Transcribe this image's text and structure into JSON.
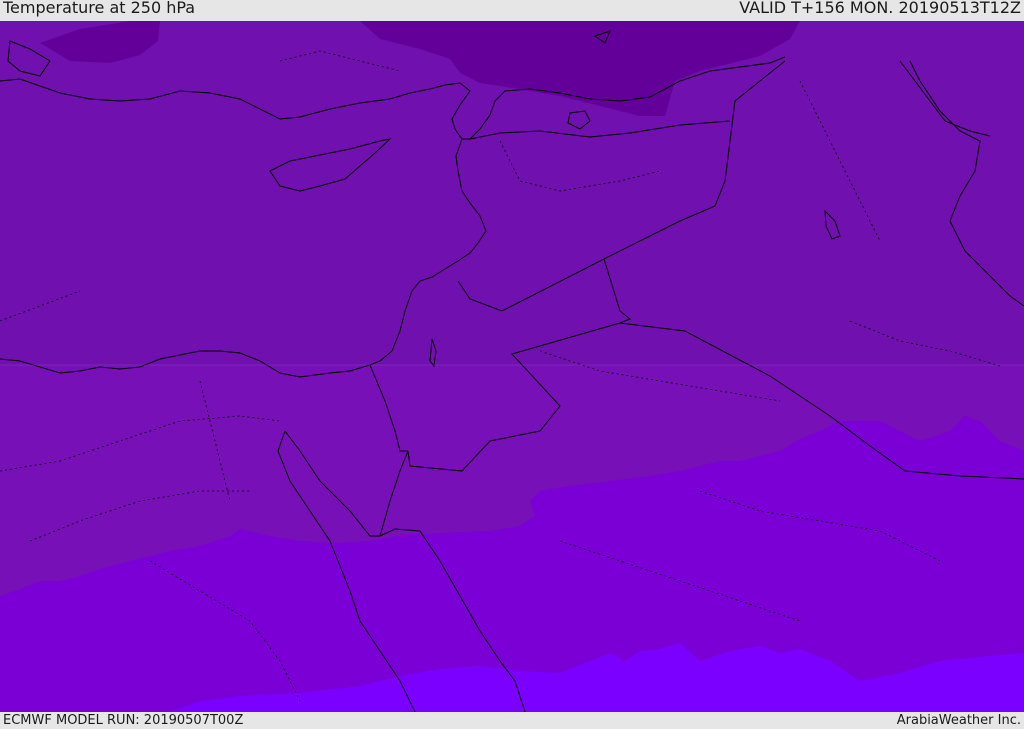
{
  "header": {
    "title": "Temperature at 250 hPa",
    "valid": "VALID T+156 MON. 20190513T12Z"
  },
  "footer": {
    "model_run": "ECMWF MODEL RUN: 20190507T00Z",
    "credit": "ArabiaWeather Inc."
  },
  "colors": {
    "band_coldest": "#63009a",
    "band_cold": "#7010ae",
    "band_mid": "#7810b8",
    "band_warm": "#7a00d6",
    "band_warmest": "#7c00ff",
    "border_line": "#000000",
    "background": "#e6e6e6"
  }
}
